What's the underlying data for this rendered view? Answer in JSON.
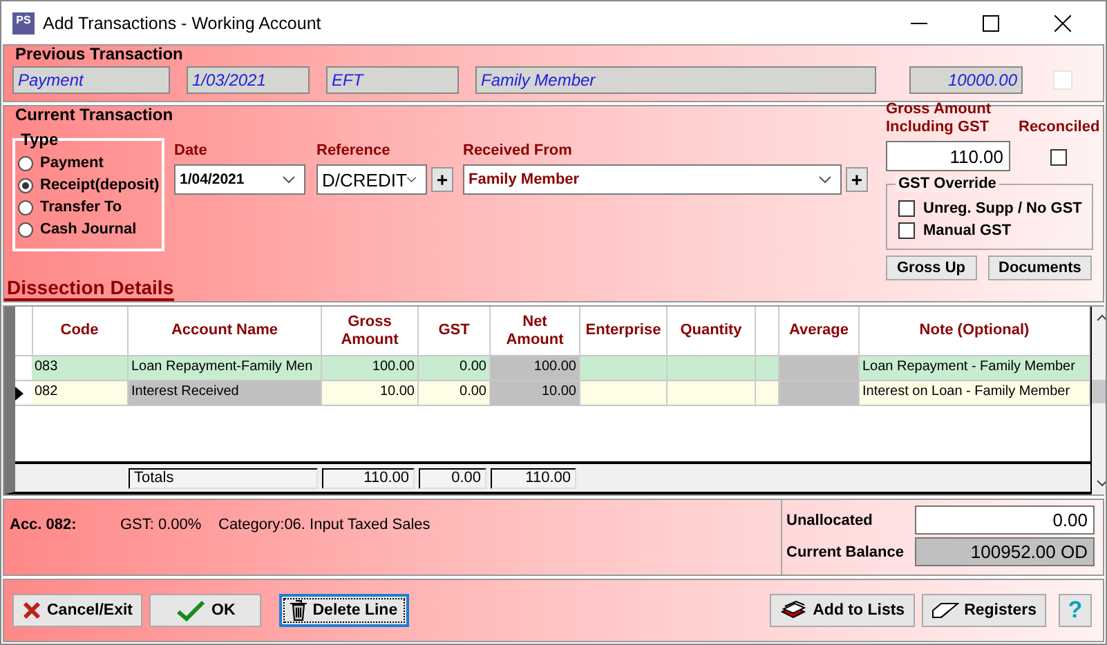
{
  "window": {
    "title": "Add Transactions - Working Account",
    "app_icon": "PS"
  },
  "previous_transaction": {
    "legend": "Previous Transaction",
    "type": "Payment",
    "date": "1/03/2021",
    "reference": "EFT",
    "received_from": "Family Member",
    "amount": "10000.00",
    "checked": false
  },
  "current_transaction": {
    "legend": "Current Transaction",
    "type_group": {
      "legend": "Type",
      "options": [
        {
          "label": "Payment",
          "selected": false
        },
        {
          "label": "Receipt(deposit)",
          "selected": true
        },
        {
          "label": "Transfer To",
          "selected": false
        },
        {
          "label": "Cash Journal",
          "selected": false
        }
      ]
    },
    "date": {
      "label": "Date",
      "value": "1/04/2021"
    },
    "reference": {
      "label": "Reference",
      "value": "D/CREDIT",
      "add": "+"
    },
    "received_from": {
      "label": "Received From",
      "value": "Family Member",
      "add": "+"
    },
    "gross_amount": {
      "label": "Gross Amount Including GST",
      "value": "110.00"
    },
    "reconciled": {
      "label": "Reconciled",
      "checked": false
    },
    "gst_override": {
      "legend": "GST Override",
      "options": [
        {
          "label": "Unreg. Supp / No GST",
          "checked": false
        },
        {
          "label": "Manual GST",
          "checked": false
        }
      ]
    },
    "buttons": [
      "Gross Up",
      "Documents"
    ]
  },
  "dissection": {
    "title": "Dissection Details",
    "columns": [
      "Code",
      "Account Name",
      "Gross Amount",
      "GST",
      "Net Amount",
      "Enterprise",
      "Quantity",
      "",
      "Average",
      "Note (Optional)"
    ],
    "rows": [
      {
        "current": false,
        "color": "#c8ecd0",
        "cells": [
          {
            "text": "083",
            "shaded": false
          },
          {
            "text": "Loan Repayment-Family Men",
            "shaded": false
          },
          {
            "text": "100.00",
            "shaded": false
          },
          {
            "text": "0.00",
            "shaded": false
          },
          {
            "text": "100.00",
            "shaded": true
          },
          {
            "shaded": false
          },
          {
            "shaded": false
          },
          {
            "shaded": false
          },
          {
            "shaded": true
          },
          {
            "text": "Loan Repayment - Family Member",
            "shaded": false
          }
        ]
      },
      {
        "current": true,
        "color": "#fffde6",
        "cells": [
          {
            "text": "082",
            "shaded": false
          },
          {
            "text": "Interest Received",
            "shaded": true
          },
          {
            "text": "10.00",
            "shaded": false
          },
          {
            "text": "0.00",
            "shaded": false
          },
          {
            "text": "10.00",
            "shaded": true
          },
          {
            "shaded": false
          },
          {
            "shaded": false
          },
          {
            "shaded": false
          },
          {
            "shaded": true
          },
          {
            "text": "Interest on Loan - Family Member",
            "shaded": false
          }
        ]
      }
    ],
    "totals": {
      "label": "Totals",
      "gross": "110.00",
      "gst": "0.00",
      "net": "110.00"
    }
  },
  "account_info": {
    "account": "Acc. 082:",
    "gst": "GST: 0.00%",
    "category": "Category:06. Input Taxed Sales"
  },
  "unallocated": {
    "label": "Unallocated",
    "value": "0.00"
  },
  "current_balance": {
    "label": "Current Balance",
    "value": "100952.00 OD"
  },
  "buttons": [
    {
      "kind": "cancel",
      "label": "Cancel/Exit",
      "focused": false
    },
    {
      "kind": "ok",
      "label": "OK",
      "focused": false
    },
    {
      "kind": "delete",
      "label": "Delete Line",
      "focused": true
    }
  ],
  "right_buttons": [
    {
      "kind": "lists",
      "label": "Add to Lists"
    },
    {
      "kind": "registers",
      "label": "Registers"
    },
    {
      "kind": "help",
      "label": "?"
    }
  ]
}
